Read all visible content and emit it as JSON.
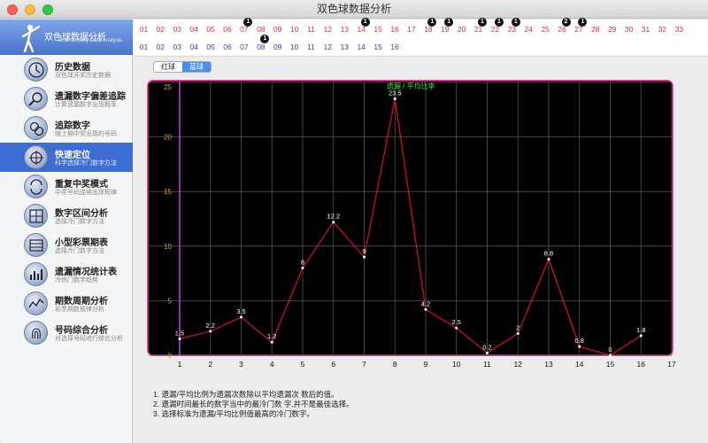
{
  "window": {
    "title": "双色球数据分析"
  },
  "banner": {
    "title": "双色球数据分析",
    "subtitle": "UnionLottery Data Analysis"
  },
  "sidebar": {
    "items": [
      {
        "title": "历史数据",
        "subtitle": "双色球开奖历史数据"
      },
      {
        "title": "遗漏数字偏差追踪",
        "subtitle": "计算遗漏数字出现概率"
      },
      {
        "title": "追踪数字",
        "subtitle": "随上期中奖出现的号码"
      },
      {
        "title": "快速定位",
        "subtitle": "科学选择冷门数字方法"
      },
      {
        "title": "重复中奖模式",
        "subtitle": "中奖号码连续出现规律"
      },
      {
        "title": "数字区间分析",
        "subtitle": "选择冷门数字方法"
      },
      {
        "title": "小型彩票期表",
        "subtitle": "选择冷门数字方法"
      },
      {
        "title": "遗漏情况统计表",
        "subtitle": "冷热门数字趋势"
      },
      {
        "title": "期数周期分析",
        "subtitle": "彩票期数规律分析"
      },
      {
        "title": "号码综合分析",
        "subtitle": "对选择号码进行综合分析"
      }
    ],
    "active_index": 3
  },
  "numbers": {
    "red": [
      "01",
      "02",
      "03",
      "04",
      "05",
      "06",
      "07",
      "08",
      "09",
      "10",
      "11",
      "12",
      "13",
      "14",
      "15",
      "16",
      "17",
      "18",
      "19",
      "20",
      "21",
      "22",
      "23",
      "24",
      "25",
      "26",
      "27",
      "28",
      "29",
      "30",
      "31",
      "32",
      "33"
    ],
    "blue": [
      "01",
      "02",
      "03",
      "04",
      "05",
      "06",
      "07",
      "08",
      "09",
      "10",
      "11",
      "12",
      "13",
      "14",
      "15",
      "16"
    ],
    "red_badges": [
      {
        "index": 6,
        "label": "1"
      },
      {
        "index": 13,
        "label": "1"
      },
      {
        "index": 17,
        "label": "1"
      },
      {
        "index": 18,
        "label": "1"
      },
      {
        "index": 20,
        "label": "1"
      },
      {
        "index": 21,
        "label": "1"
      },
      {
        "index": 22,
        "label": "1"
      },
      {
        "index": 25,
        "label": "2"
      },
      {
        "index": 26,
        "label": "1"
      }
    ],
    "blue_badges": [
      {
        "index": 7,
        "label": "1"
      }
    ]
  },
  "tabs": {
    "red": "红球",
    "blue": "蓝球",
    "selected": "blue"
  },
  "chart_data": {
    "type": "line",
    "title": "遗漏 / 平均比率",
    "x": [
      1,
      2,
      3,
      4,
      5,
      6,
      7,
      8,
      9,
      10,
      11,
      12,
      13,
      14,
      15,
      16
    ],
    "values": [
      1.5,
      2.2,
      3.5,
      1.2,
      8,
      12.2,
      9,
      23.5,
      4.2,
      2.5,
      0.2,
      2,
      8.8,
      0.8,
      0,
      1.8
    ],
    "data_labels": [
      "1.5",
      "2.2",
      "3.5",
      "1.2",
      "8",
      "12.2",
      "9",
      "23.5",
      "4.2",
      "2.5",
      "0.2",
      "2",
      "8.8",
      "0.8",
      "0",
      "1.8"
    ],
    "xlim": [
      0,
      17
    ],
    "ylim": [
      0,
      25
    ],
    "x_ticks": [
      1,
      2,
      3,
      4,
      5,
      6,
      7,
      8,
      9,
      10,
      11,
      12,
      13,
      14,
      15,
      16,
      17
    ],
    "y_ticks": [
      0,
      5,
      10,
      15,
      20,
      25
    ],
    "grid": true,
    "colors": {
      "background": "#000000",
      "grid": "#555555",
      "line": "#cc1122",
      "label": "#ffffff",
      "ytick": "#d4a32a",
      "title": "#33dd33",
      "border": "#e0208a",
      "yaxis": "#c040e0"
    }
  },
  "notes": [
    "1. 遗漏/平均比例为遗漏次数除以平均遗漏次 数后的值。",
    "2. 遗漏时间最长的数字当中的最冷门数 字,并不是最佳选择。",
    "3. 选择标准为遗漏/平均比例值最高的冷门数字。"
  ]
}
